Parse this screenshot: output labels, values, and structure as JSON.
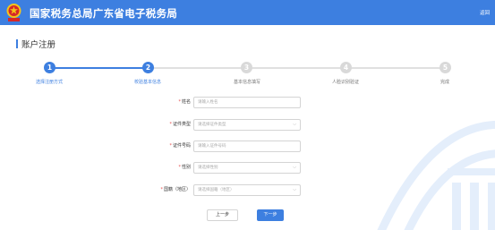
{
  "header": {
    "title": "国家税务总局广东省电子税务局",
    "right_text": "返回"
  },
  "page": {
    "title": "账户注册"
  },
  "steps": [
    {
      "number": "1",
      "label": "选择注册方式",
      "active": true
    },
    {
      "number": "2",
      "label": "校验基本信息",
      "active": true
    },
    {
      "number": "3",
      "label": "基本信息填写",
      "active": false
    },
    {
      "number": "4",
      "label": "人脸识别验证",
      "active": false
    },
    {
      "number": "5",
      "label": "完成",
      "active": false
    }
  ],
  "form": {
    "name": {
      "label": "姓名",
      "placeholder": "请输入姓名"
    },
    "id_type": {
      "label": "证件类型",
      "placeholder": "请选择证件类型"
    },
    "id_number": {
      "label": "证件号码",
      "placeholder": "请输入证件号码"
    },
    "gender": {
      "label": "性别",
      "placeholder": "请选择性别"
    },
    "nationality": {
      "label": "国籍（地区）",
      "placeholder": "请选择国籍（地区）"
    }
  },
  "buttons": {
    "prev": "上一步",
    "next": "下一步"
  },
  "colors": {
    "brand": "#3d7fe0",
    "required": "#e64c4c",
    "inactive_step": "#d9d9d9"
  },
  "icons": {
    "chevron": "chevron-down-icon"
  }
}
